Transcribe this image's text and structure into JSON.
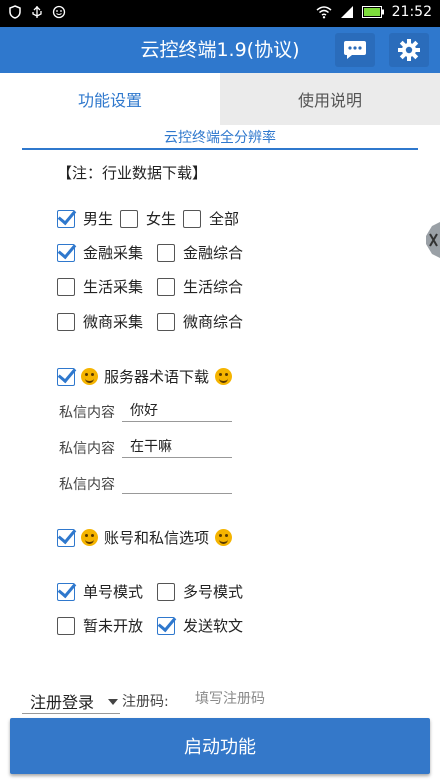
{
  "status_bar": {
    "time": "21:52"
  },
  "header": {
    "title": "云控终端1.9(协议)",
    "chat_icon": "chat-bubble-icon",
    "settings_icon": "gear-icon",
    "accent": "#2f78cd"
  },
  "tabs": [
    {
      "label": "功能设置",
      "active": true
    },
    {
      "label": "使用说明",
      "active": false
    }
  ],
  "subtitle": "云控终端全分辨率",
  "note": "【注：行业数据下载】",
  "gender": [
    {
      "label": "男生",
      "checked": true
    },
    {
      "label": "女生",
      "checked": false
    },
    {
      "label": "全部",
      "checked": false
    }
  ],
  "industry": [
    {
      "label": "金融采集",
      "checked": true
    },
    {
      "label": "金融综合",
      "checked": false
    },
    {
      "label": "生活采集",
      "checked": false
    },
    {
      "label": "生活综合",
      "checked": false
    },
    {
      "label": "微商采集",
      "checked": false
    },
    {
      "label": "微商综合",
      "checked": false
    }
  ],
  "server_download": {
    "label": "服务器术语下载",
    "checked": true
  },
  "private_messages": [
    {
      "label": "私信内容",
      "value": "你好"
    },
    {
      "label": "私信内容",
      "value": "在干嘛"
    },
    {
      "label": "私信内容",
      "value": ""
    }
  ],
  "account_options": {
    "label": "账号和私信选项",
    "checked": true
  },
  "modes": [
    {
      "label": "单号模式",
      "checked": true
    },
    {
      "label": "多号模式",
      "checked": false
    },
    {
      "label": "暂未开放",
      "checked": false
    },
    {
      "label": "发送软文",
      "checked": true
    }
  ],
  "register": {
    "select_value": "注册登录",
    "code_label": "注册码:",
    "code_placeholder": "填写注册码"
  },
  "start_button": "启动功能"
}
